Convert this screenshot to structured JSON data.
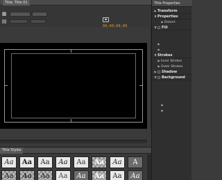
{
  "designer": {
    "tab_label": "Title: Title 01",
    "timecode": "00;00;00;00"
  },
  "properties": {
    "tab_label": "Title Properties",
    "rows": [
      {
        "label": "Transform",
        "kind": "h",
        "toggle": "closed"
      },
      {
        "label": "Properties",
        "kind": "h",
        "toggle": "open"
      },
      {
        "label": "Distort",
        "kind": "n",
        "toggle": "closed",
        "indent": 2
      },
      {
        "label": "Fill",
        "kind": "h",
        "toggle": "open",
        "check": true
      },
      {
        "label": "",
        "kind": "d",
        "toggle": "",
        "indent": 1
      },
      {
        "label": "",
        "kind": "d",
        "toggle": "",
        "indent": 1
      },
      {
        "label": "",
        "kind": "d",
        "toggle": "closed",
        "indent": 1
      },
      {
        "label": "",
        "kind": "d",
        "toggle": "closed",
        "indent": 1
      },
      {
        "label": "Strokes",
        "kind": "h",
        "toggle": "open"
      },
      {
        "label": "Inner Strokes",
        "kind": "n",
        "toggle": "closed",
        "indent": 1
      },
      {
        "label": "Outer Strokes",
        "kind": "n",
        "toggle": "closed",
        "indent": 1
      },
      {
        "label": "Shadow",
        "kind": "h",
        "toggle": "closed",
        "check": true
      },
      {
        "label": "Background",
        "kind": "h",
        "toggle": "open",
        "check": true
      },
      {
        "label": "",
        "kind": "d",
        "toggle": "",
        "indent": 1
      },
      {
        "label": "",
        "kind": "d",
        "toggle": "",
        "indent": 1
      },
      {
        "label": "",
        "kind": "d",
        "toggle": "",
        "indent": 1
      },
      {
        "label": "",
        "kind": "d",
        "toggle": "",
        "indent": 1
      },
      {
        "label": "",
        "kind": "d",
        "toggle": "closed",
        "indent": 2
      },
      {
        "label": "",
        "kind": "d",
        "toggle": "closed",
        "indent": 2
      }
    ]
  },
  "styles": {
    "tab_label": "Title Styles",
    "swatches": [
      {
        "text": "Aa",
        "variant": "light",
        "color": "#222222"
      },
      {
        "text": "Aa",
        "variant": "light",
        "color": "#222222"
      },
      {
        "text": "Aa",
        "variant": "light",
        "color": "#222222"
      },
      {
        "text": "Aa",
        "variant": "light",
        "color": "#111111"
      },
      {
        "text": "Aa",
        "variant": "light",
        "color": "#333333"
      },
      {
        "text": "Aa",
        "variant": "checker",
        "color": "#ffffff"
      },
      {
        "text": "Aa",
        "variant": "light",
        "color": "#222222"
      },
      {
        "text": "A",
        "variant": "dark",
        "color": "#ffffff"
      },
      {
        "text": "Aa",
        "variant": "checker",
        "color": "#222222"
      },
      {
        "text": "Aa",
        "variant": "checker",
        "color": "#333333"
      },
      {
        "text": "Aa",
        "variant": "checker",
        "color": "#222222"
      },
      {
        "text": "Aa",
        "variant": "light",
        "color": "#444444"
      },
      {
        "text": "Aa",
        "variant": "dark",
        "color": "#ffffff"
      },
      {
        "text": "Aa",
        "variant": "checker",
        "color": "#ffffff"
      },
      {
        "text": "Aa",
        "variant": "light",
        "color": "#222222"
      },
      {
        "text": "Aa",
        "variant": "dark",
        "color": "#ffffff"
      }
    ]
  }
}
